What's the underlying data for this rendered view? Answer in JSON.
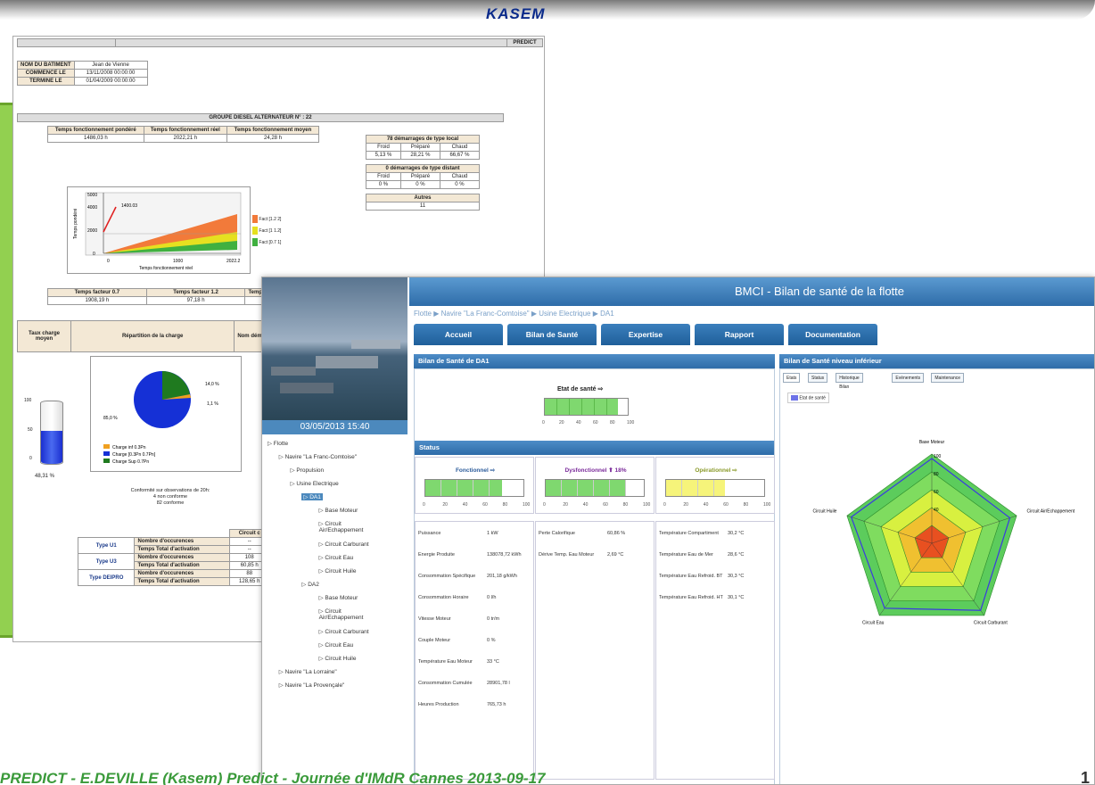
{
  "header": {
    "logo": "KASEM"
  },
  "report": {
    "predict": "PREDICT",
    "ship": [
      {
        "k": "NOM DU BATIMENT",
        "v": "Jean de Vienne"
      },
      {
        "k": "COMMENCE LE",
        "v": "13/11/2008 00:00:00"
      },
      {
        "k": "TERMINE LE",
        "v": "01/04/2009 00:00:00"
      }
    ],
    "group_title": "GROUPE DIESEL ALTERNATEUR N° : 22",
    "tf_headers": [
      "Temps fonctionnement pondéré",
      "Temps fonctionnement réel",
      "Temps fonctionnement moyen"
    ],
    "tf_values": [
      "1486,03 h",
      "2022,21 h",
      "24,28 h"
    ],
    "local_title": "78 démarrages de type local",
    "start_cols": [
      "Froid",
      "Préparé",
      "Chaud"
    ],
    "local_values": [
      "5,13 %",
      "28,21 %",
      "66,67 %"
    ],
    "distant_title": "0 démarrages de type distant",
    "distant_values": [
      "0 %",
      "0 %",
      "0 %"
    ],
    "autres_label": "Autres",
    "autres_value": "11",
    "chart1": {
      "point": "1400.03",
      "yticks": [
        "5000",
        "4000",
        "2000",
        "0"
      ],
      "xticks": [
        "0",
        "1000",
        "2022.2"
      ],
      "xlabel": "Temps fonctionnement réel",
      "ylabel": "Temps pondéré",
      "legend": [
        "Fact [1.2 2]",
        "Fact [1 1.2]",
        "Fact [0.7 1]"
      ]
    },
    "factor_headers": [
      "Temps facteur 0.7",
      "Temps facteur 1.2",
      "Temp"
    ],
    "factor_values": [
      "1908,19 h",
      "97,18 h",
      ""
    ],
    "charge_headers": [
      "Taux charge moyen",
      "Répartition de la charge",
      "Nom déma"
    ],
    "pie": {
      "labels": [
        "14,0 %",
        "1,1 %",
        "85,0 %"
      ],
      "legend": [
        "Charge inf 0.3Pn",
        "Charge [0.3Pn 0.7Pn]",
        "Charge Sup 0.7Pn"
      ]
    },
    "tank": {
      "ticks": [
        "100",
        "50",
        "0"
      ],
      "value": "48,31 %"
    },
    "conformity": [
      "Conformité sur observations de 20h:",
      "4 non conforme",
      "82 conforme"
    ],
    "circuit": "Circuit c",
    "types": [
      {
        "name": "Type U1",
        "rows": [
          {
            "k": "Nombre d'occurences",
            "v": "--"
          },
          {
            "k": "Temps Total d'activation",
            "v": "--"
          }
        ]
      },
      {
        "name": "Type U3",
        "rows": [
          {
            "k": "Nombre d'occurences",
            "v": "108"
          },
          {
            "k": "Temps Total d'activation",
            "v": "60,85 h"
          }
        ]
      },
      {
        "name": "Type DEIPRO",
        "rows": [
          {
            "k": "Nombre d'occurences",
            "v": "88"
          },
          {
            "k": "Temps Total d'activation",
            "v": "128,65 h"
          }
        ]
      }
    ]
  },
  "bmci": {
    "title": "BMCI - Bilan de santé de la flotte",
    "date": "03/05/2013 15:40",
    "breadcrumb": "Flotte ▶ Navire \"La Franc-Comtoise\" ▶ Usine Electrique ▶ DA1",
    "tabs": [
      "Accueil",
      "Bilan de Santé",
      "Expertise",
      "Rapport",
      "Documentation"
    ],
    "tree": [
      "Flotte",
      "Navire \"La Franc-Comtoise\"",
      "Propulsion",
      "Usine Electrique",
      "DA1",
      "Base Moteur",
      "Circuit",
      "Air/Echappement",
      "Circuit Carburant",
      "Circuit Eau",
      "Circuit Huile",
      "DA2",
      "Base Moteur",
      "Circuit",
      "Air/Echappement",
      "Circuit Carburant",
      "Circuit Eau",
      "Circuit Huile",
      "Navire \"La Lorraine\"",
      "Navire \"La Provençale\""
    ],
    "left_title": "Bilan de Santé de DA1",
    "etat_label": "Etat de santé ⇨",
    "etat_value": 0.88,
    "gauge_ticks": [
      "0",
      "20",
      "40",
      "60",
      "80",
      "100"
    ],
    "status_title": "Status",
    "status": [
      {
        "label": "Fonctionnel ⇨",
        "value": 0.78,
        "color": "#7fd86f"
      },
      {
        "label": "Dysfonctionnel ⬆ 18%",
        "value": 0.82,
        "color": "#7fd86f"
      },
      {
        "label": "Opérationnel ⇨",
        "value": 0.6,
        "color": "#f6f47a"
      }
    ],
    "col1": [
      {
        "k": "Puissance",
        "v": "1 kW"
      },
      {
        "k": "Energie Produite",
        "v": "138078,72 kWh"
      },
      {
        "k": "Consommation Spécifique",
        "v": "201,18 g/kWh"
      },
      {
        "k": "Consommation Horaire",
        "v": "0 l/h"
      },
      {
        "k": "Vitesse Moteur",
        "v": "0 tr/m"
      },
      {
        "k": "Couple Moteur",
        "v": "0 %"
      },
      {
        "k": "Température Eau Moteur",
        "v": "33 °C"
      },
      {
        "k": "Consommation Cumulée",
        "v": "28901,78 l"
      },
      {
        "k": "Heures Production",
        "v": "765,73 h"
      }
    ],
    "col2": [
      {
        "k": "Perte Calorifique",
        "v": "60,86 %"
      },
      {
        "k": "Dérive Temp. Eau Moteur",
        "v": "2,69 °C"
      }
    ],
    "col3": [
      {
        "k": "Température Compartiment",
        "v": "30,2 °C"
      },
      {
        "k": "Température Eau de Mer",
        "v": "28,6 °C"
      },
      {
        "k": "Température Eau Refroid. BT",
        "v": "30,3 °C"
      },
      {
        "k": "Température Eau Refroid. HT",
        "v": "30,1 °C"
      }
    ],
    "right_title": "Bilan de Santé niveau inférieur",
    "subtabs": [
      "Etats",
      "Status",
      "Historique Bilan",
      "Evènements",
      "Maintenance"
    ],
    "radar_legend": "Etat de santé",
    "radar_labels": [
      "Base Moteur",
      "Circuit Air/Echappement",
      "Circuit Carburant",
      "Circuit Eau",
      "Circuit Huile"
    ],
    "radar_ticks": [
      "100",
      "80",
      "60",
      "40"
    ],
    "radar_values": [
      95,
      92,
      93,
      90,
      95
    ]
  },
  "footer": {
    "text": "PREDICT - E.DEVILLE (Kasem) Predict - Journée d'IMdR Cannes 2013-09-17",
    "page": "1"
  }
}
